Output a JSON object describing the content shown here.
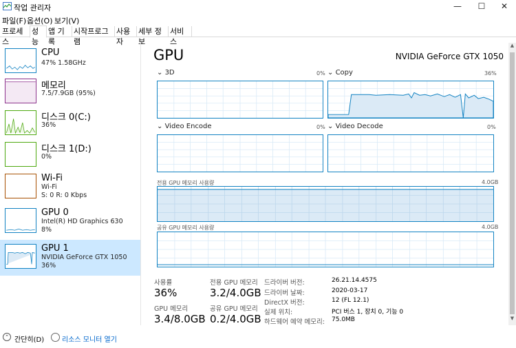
{
  "window": {
    "title": "작업 관리자",
    "minimize": "—",
    "maximize": "☐",
    "close": "✕"
  },
  "menu": [
    "파일(F)",
    "옵션(O)",
    "보기(V)"
  ],
  "tabs": [
    "프로세스",
    "성능",
    "앱 기록",
    "시작프로그램",
    "사용자",
    "세부 정보",
    "서비스"
  ],
  "active_tab": "성능",
  "resources": [
    {
      "name": "CPU",
      "lines": [
        "47% 1.58GHz"
      ],
      "color": "#1182c2"
    },
    {
      "name": "메모리",
      "lines": [
        "7.5/7.9GB (95%)"
      ],
      "color": "#8b2e8b"
    },
    {
      "name": "디스크 0(C:)",
      "lines": [
        "36%"
      ],
      "color": "#4da80e"
    },
    {
      "name": "디스크 1(D:)",
      "lines": [
        "0%"
      ],
      "color": "#4da80e"
    },
    {
      "name": "Wi-Fi",
      "lines": [
        "Wi-Fi",
        "S: 0 R: 0 Kbps"
      ],
      "color": "#a74f01"
    },
    {
      "name": "GPU 0",
      "lines": [
        "Intel(R) HD Graphics 630",
        "8%"
      ],
      "color": "#1182c2"
    },
    {
      "name": "GPU 1",
      "lines": [
        "NVIDIA GeForce GTX 1050",
        "36%"
      ],
      "color": "#1182c2"
    }
  ],
  "selected_resource": "GPU 1",
  "main": {
    "title": "GPU",
    "model": "NVIDIA GeForce GTX 1050",
    "graphs": [
      {
        "label": "3D",
        "pct": "0%"
      },
      {
        "label": "Copy",
        "pct": "36%"
      },
      {
        "label": "Video Encode",
        "pct": "0%"
      },
      {
        "label": "Video Decode",
        "pct": "0%"
      }
    ],
    "dedicated_mem_label": "전용 GPU 메모리 사용량",
    "dedicated_mem_max": "4.0GB",
    "shared_mem_label": "공유 GPU 메모리 사용량",
    "shared_mem_max": "4.0GB",
    "stats": {
      "usage_label": "사용률",
      "usage_value": "36%",
      "gpu_mem_label": "GPU 메모리",
      "gpu_mem_value": "3.4/8.0GB",
      "dedicated_label": "전용 GPU 메모리",
      "dedicated_value": "3.2/4.0GB",
      "shared_label": "공유 GPU 메모리",
      "shared_value": "0.2/4.0GB"
    },
    "info": [
      {
        "label": "드라이버 버전:",
        "value": "26.21.14.4575"
      },
      {
        "label": "드라이버 날짜:",
        "value": "2020-03-17"
      },
      {
        "label": "DirectX 버전:",
        "value": "12 (FL 12.1)"
      },
      {
        "label": "실제 위치:",
        "value": "PCI 버스 1, 장치 0, 기능 0"
      },
      {
        "label": "하드웨어 예약 메모리:",
        "value": "75.0MB"
      }
    ]
  },
  "footer": {
    "simple": "간단히(D)",
    "resource_monitor": "리소스 모니터 열기"
  },
  "colors": {
    "accent": "#1182c2",
    "selected_bg": "#cce8ff",
    "grid": "#d9eaf7",
    "link": "#0066cc"
  }
}
